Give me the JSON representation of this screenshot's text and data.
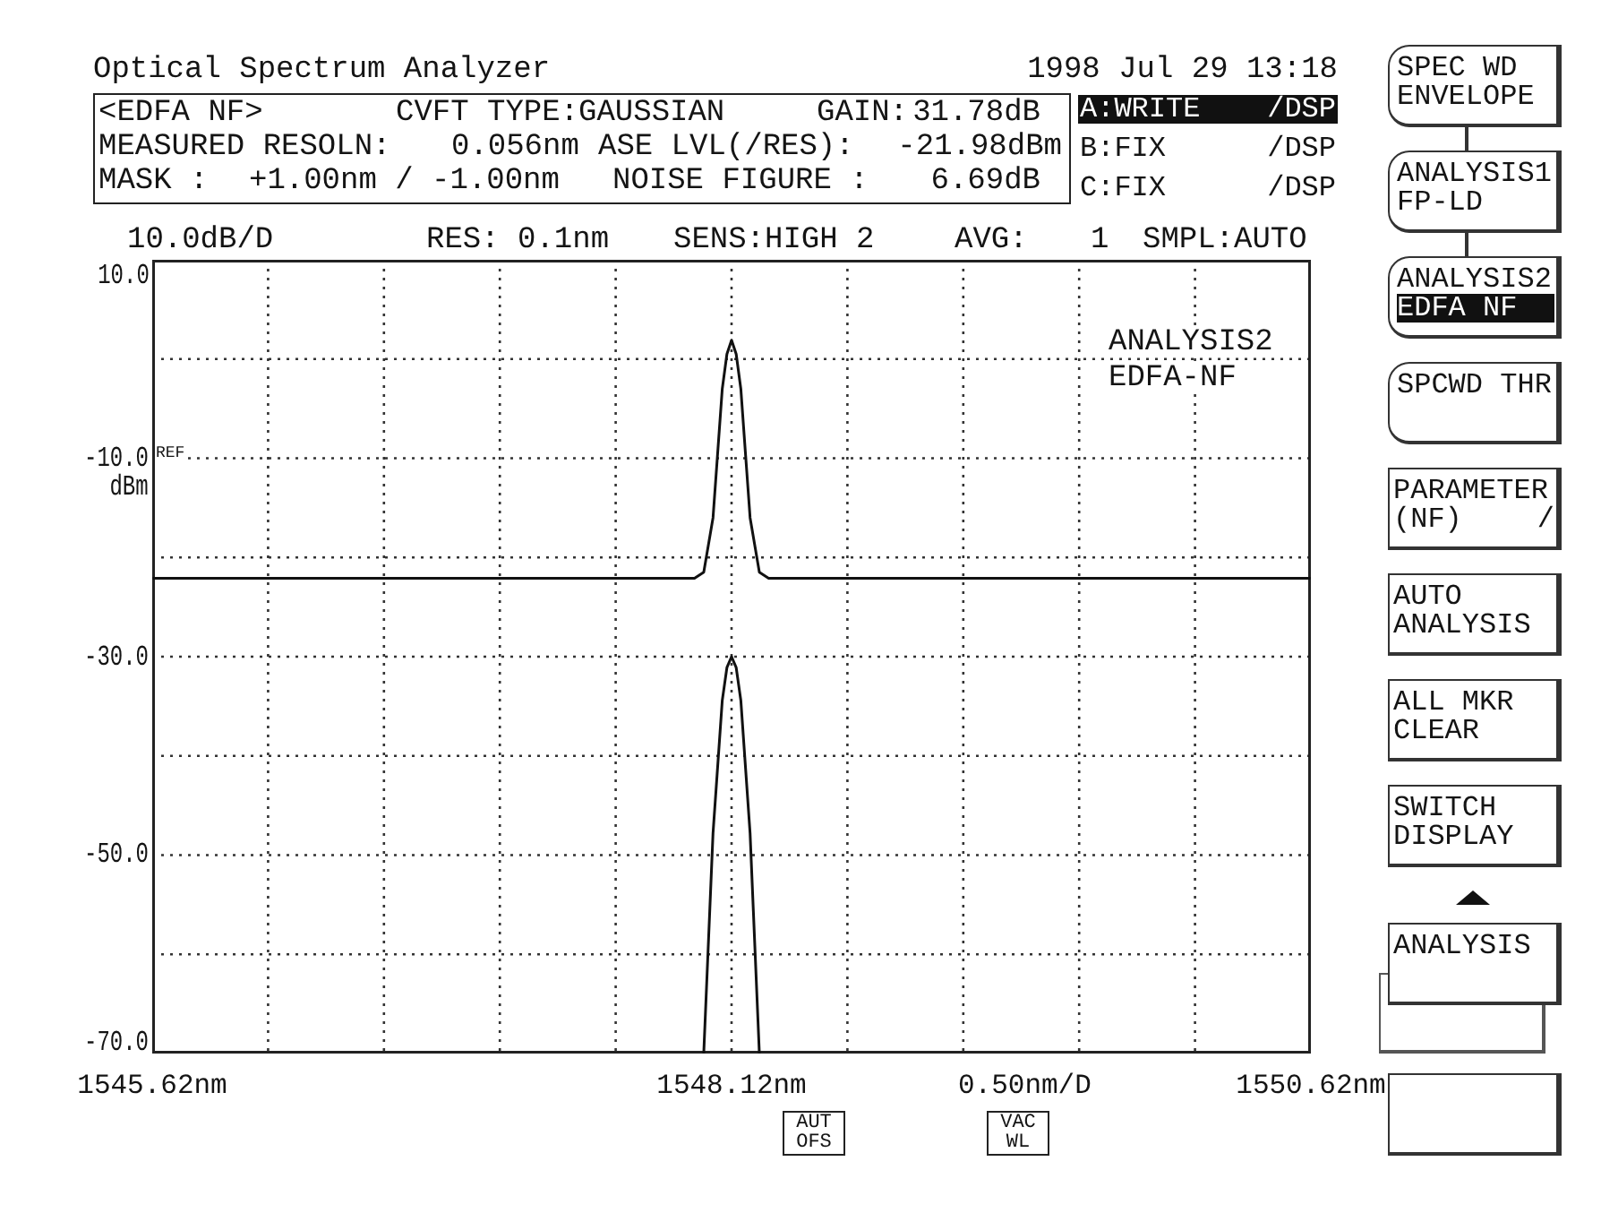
{
  "header": {
    "title": "Optical Spectrum Analyzer",
    "datetime": "1998 Jul 29 13:18"
  },
  "analysis_box": {
    "rows": [
      [
        "<EDFA NF>",
        "CVFT TYPE:GAUSSIAN",
        "GAIN:",
        "31.78dB"
      ],
      [
        "MEASURED RESOLN:",
        "0.056nm",
        "ASE LVL(/RES):",
        "-21.98dBm"
      ],
      [
        "MASK :",
        "+1.00nm / -1.00nm",
        "NOISE FIGURE :",
        "6.69dB"
      ]
    ]
  },
  "trace_memories": [
    {
      "label": "A:WRITE",
      "mode": "/DSP",
      "selected": true
    },
    {
      "label": "B:FIX",
      "mode": "/DSP",
      "selected": false
    },
    {
      "label": "C:FIX",
      "mode": "/DSP",
      "selected": false
    }
  ],
  "settings": [
    "10.0dB/D",
    "RES: 0.1nm",
    "SENS:HIGH 2",
    "AVG:",
    "1",
    "SMPL:AUTO"
  ],
  "display": {
    "ref_marker": "REF",
    "x_scale": "0.50nm/D",
    "badges": [
      {
        "lines": [
          "AUT",
          "OFS"
        ]
      },
      {
        "lines": [
          "VAC",
          "WL"
        ]
      }
    ],
    "chart_data": {
      "type": "line",
      "ylabel": "dBm",
      "x": [
        1545.62,
        1547.96,
        1548.0,
        1548.04,
        1548.08,
        1548.1,
        1548.12,
        1548.14,
        1548.16,
        1548.2,
        1548.24,
        1548.28,
        1550.62
      ],
      "series": [
        {
          "values": [
            -22.1,
            -22.1,
            -21.5,
            -16,
            -3,
            0.5,
            1.9,
            0.5,
            -3,
            -16,
            -21.5,
            -22.1,
            -22.1
          ]
        },
        {
          "values": [
            null,
            null,
            -70,
            -47.8,
            -34.4,
            -31.1,
            -30,
            -31.1,
            -34.4,
            -47.8,
            -70,
            null,
            null
          ]
        }
      ],
      "xlim": [
        1545.62,
        1550.62
      ],
      "ylim": [
        -70,
        10
      ],
      "xticks": [
        {
          "value": 1545.62,
          "label": "1545.62nm"
        },
        {
          "value": 1548.12,
          "label": "1548.12nm"
        },
        {
          "value": 1550.62,
          "label": "1550.62nm"
        }
      ],
      "yticks": [
        {
          "value": 10,
          "label": "10.0"
        },
        {
          "value": -10,
          "label": "-10.0"
        },
        {
          "value": -30,
          "label": "-30.0"
        },
        {
          "value": -50,
          "label": "-50.0"
        },
        {
          "value": -70,
          "label": "-70.0"
        }
      ],
      "grid": true,
      "annotations": [
        {
          "text": "ANALYSIS2"
        },
        {
          "text": "EDFA-NF"
        }
      ]
    }
  },
  "softkeys": [
    {
      "lines": [
        "SPEC WD",
        "ENVELOPE"
      ],
      "kind": "bracket",
      "linked": true,
      "selected": false
    },
    {
      "lines": [
        "ANALYSIS1",
        "FP-LD"
      ],
      "kind": "bracket",
      "linked": true,
      "selected": false
    },
    {
      "lines": [
        "ANALYSIS2",
        "EDFA NF"
      ],
      "kind": "bracket",
      "linked": false,
      "selected": true
    },
    {
      "lines": [
        "SPCWD THR"
      ],
      "kind": "bracket",
      "linked": false,
      "selected": false
    },
    {
      "lines": [
        "PARAMETER",
        "(NF)"
      ],
      "suffix": "/",
      "kind": "plain"
    },
    {
      "lines": [
        "AUTO",
        "ANALYSIS"
      ],
      "kind": "plain"
    },
    {
      "lines": [
        "ALL MKR",
        "CLEAR"
      ],
      "kind": "plain"
    },
    {
      "lines": [
        "SWITCH",
        "DISPLAY"
      ],
      "kind": "plain"
    },
    {
      "lines": [
        "ANALYSIS"
      ],
      "kind": "stacked"
    },
    {
      "kind": "plain"
    }
  ]
}
